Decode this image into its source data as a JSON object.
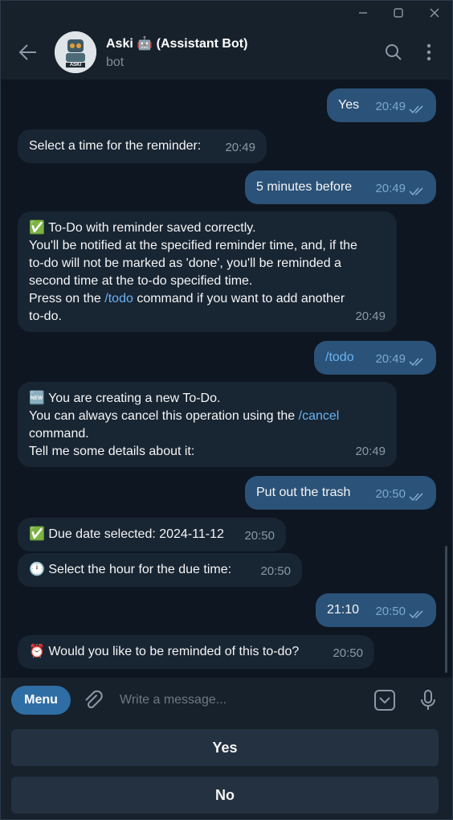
{
  "header": {
    "name": "Aski 🤖 (Assistant Bot)",
    "status": "bot",
    "avatar_text": "ASKI"
  },
  "messages": [
    {
      "dir": "out",
      "text": "Yes",
      "time": "20:49"
    },
    {
      "dir": "in",
      "text": "Select a time for the reminder:",
      "time": "20:49"
    },
    {
      "dir": "out",
      "text": "5 minutes before",
      "time": "20:49"
    },
    {
      "dir": "in",
      "lines": [
        "✅ To-Do with reminder saved correctly.",
        "You'll be notified at the specified reminder time, and, if the",
        "to-do will not be marked as 'done', you'll be reminded a",
        "second time at the to-do specified time.",
        "Press on the",
        "/todo",
        "command if you want to add another",
        "to-do."
      ],
      "time": "20:49"
    },
    {
      "dir": "out",
      "text": "/todo",
      "time": "20:49"
    },
    {
      "dir": "in",
      "lines": [
        "🆕 You are creating a new To-Do.",
        "You can always cancel this operation using the",
        "/cancel",
        "command.",
        "Tell me some details about it:"
      ],
      "time": "20:49"
    },
    {
      "dir": "out",
      "text": "Put out the trash",
      "time": "20:50"
    },
    {
      "dir": "in",
      "text": "✅ Due date selected: 2024-11-12",
      "time": "20:50"
    },
    {
      "dir": "in",
      "text": "🕛 Select the hour for the due time:",
      "time": "20:50"
    },
    {
      "dir": "out",
      "text": "21:10",
      "time": "20:50"
    },
    {
      "dir": "in",
      "text": "⏰ Would you like to be reminded of this to-do?",
      "time": "20:50"
    }
  ],
  "composer": {
    "menu_label": "Menu",
    "placeholder": "Write a message..."
  },
  "keyboard": {
    "buttons": [
      "Yes",
      "No"
    ]
  },
  "colors": {
    "background": "#0e1621",
    "panel": "#17212b",
    "incoming_bubble": "#182533",
    "outgoing_bubble": "#2b5278",
    "link": "#6ab2f2",
    "menu_button": "#2f6ea5"
  },
  "icons": [
    "back-arrow-icon",
    "search-icon",
    "more-vertical-icon",
    "attach-icon",
    "sticker-icon",
    "microphone-icon",
    "double-check-icon"
  ]
}
